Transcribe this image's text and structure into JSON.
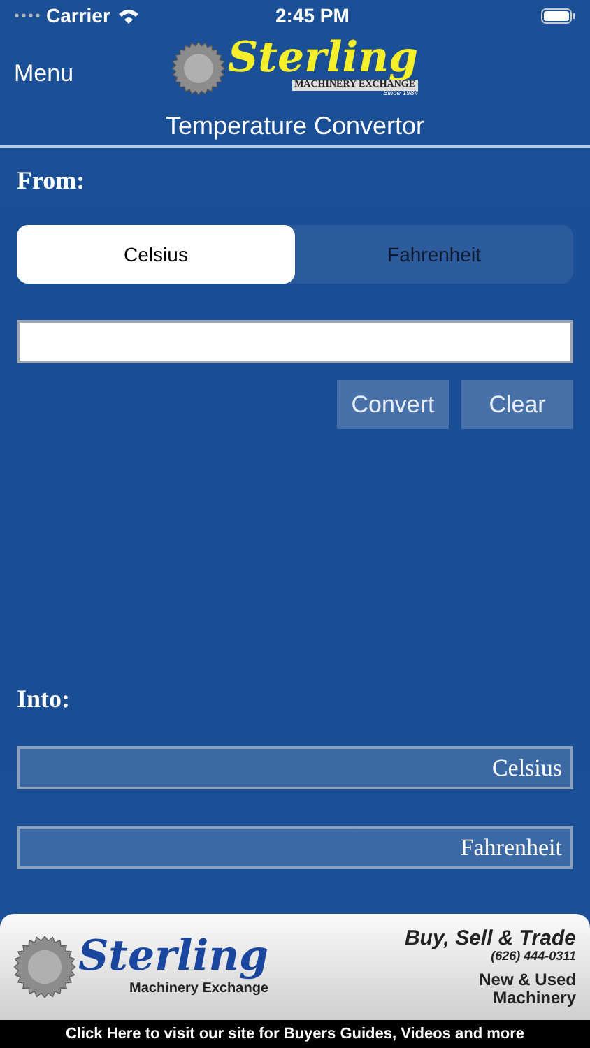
{
  "status_bar": {
    "carrier": "Carrier",
    "time": "2:45 PM"
  },
  "nav": {
    "menu": "Menu",
    "logo": {
      "script": "Sterling",
      "subtitle": "MACHINERY EXCHANGE",
      "since": "Since 1984"
    },
    "title": "Temperature Convertor"
  },
  "from": {
    "label": "From:",
    "segments": [
      {
        "label": "Celsius",
        "selected": true
      },
      {
        "label": "Fahrenheit",
        "selected": false
      }
    ],
    "buttons": [
      "Convert",
      "Clear"
    ]
  },
  "into": {
    "label": "Into:",
    "outputs": [
      {
        "placeholder": "Celsius"
      },
      {
        "placeholder": "Fahrenheit"
      }
    ]
  },
  "banner": {
    "script": "Sterling",
    "subtitle": "Machinery Exchange",
    "headline": "Buy, Sell & Trade",
    "phone": "(626) 444-0311",
    "tag_lines": [
      "New & Used",
      "Machinery"
    ],
    "link": "Click Here to visit our site for Buyers Guides, Videos and more"
  }
}
